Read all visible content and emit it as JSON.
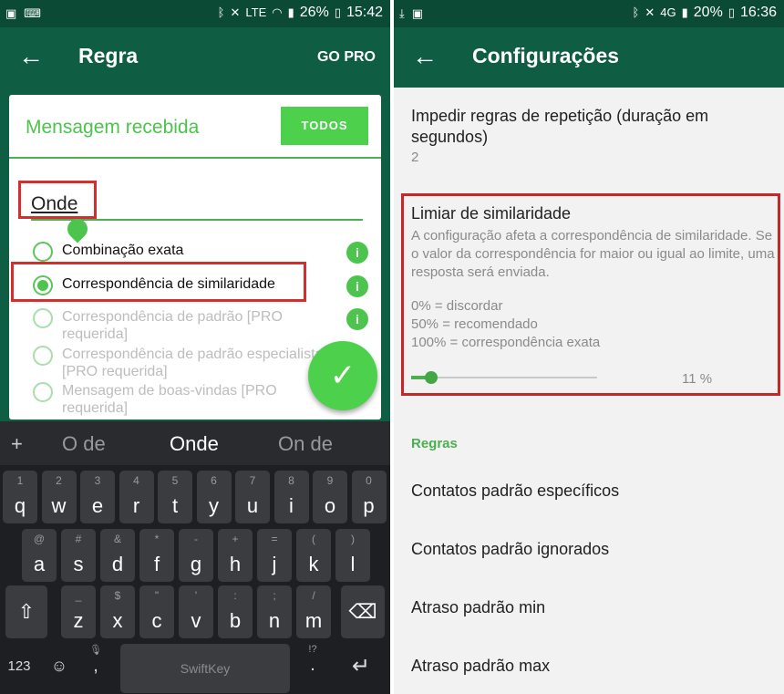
{
  "left": {
    "status": {
      "battery": "26%",
      "time": "15:42",
      "network": "LTE"
    },
    "appbar": {
      "back_icon": "arrow-left-icon",
      "title": "Regra",
      "action": "GO PRO"
    },
    "card": {
      "title": "Mensagem recebida",
      "todos_label": "TODOS",
      "input_value": "Onde",
      "options": [
        {
          "label": "Combinação exata",
          "checked": false,
          "disabled": false,
          "info": true
        },
        {
          "label": "Correspondência de similaridade",
          "checked": true,
          "disabled": false,
          "info": true
        },
        {
          "label": "Correspondência de padrão [PRO requerida]",
          "checked": false,
          "disabled": true,
          "info": true
        },
        {
          "label": "Correspondência de padrão especialista [PRO requerida]",
          "checked": false,
          "disabled": true,
          "info": false
        },
        {
          "label": "Mensagem de boas-vindas [PRO requerida]",
          "checked": false,
          "disabled": true,
          "info": false
        }
      ],
      "info_glyph": "i",
      "fab_icon": "check-icon"
    },
    "keyboard": {
      "plus": "+",
      "suggestions": [
        "O de",
        "Onde",
        "On de"
      ],
      "row1": [
        {
          "sub": "1",
          "main": "q"
        },
        {
          "sub": "2",
          "main": "w"
        },
        {
          "sub": "3",
          "main": "e"
        },
        {
          "sub": "4",
          "main": "r"
        },
        {
          "sub": "5",
          "main": "t"
        },
        {
          "sub": "6",
          "main": "y"
        },
        {
          "sub": "7",
          "main": "u"
        },
        {
          "sub": "8",
          "main": "i"
        },
        {
          "sub": "9",
          "main": "o"
        },
        {
          "sub": "0",
          "main": "p"
        }
      ],
      "row2": [
        {
          "sub": "@",
          "main": "a"
        },
        {
          "sub": "#",
          "main": "s"
        },
        {
          "sub": "&",
          "main": "d"
        },
        {
          "sub": "*",
          "main": "f"
        },
        {
          "sub": "-",
          "main": "g"
        },
        {
          "sub": "+",
          "main": "h"
        },
        {
          "sub": "=",
          "main": "j"
        },
        {
          "sub": "(",
          "main": "k"
        },
        {
          "sub": ")",
          "main": "l"
        }
      ],
      "row3": [
        {
          "sub": "_",
          "main": "z"
        },
        {
          "sub": "$",
          "main": "x"
        },
        {
          "sub": "\"",
          "main": "c"
        },
        {
          "sub": "'",
          "main": "v"
        },
        {
          "sub": ":",
          "main": "b"
        },
        {
          "sub": ";",
          "main": "n"
        },
        {
          "sub": "/",
          "main": "m"
        }
      ],
      "shift_icon": "shift-icon",
      "backspace_icon": "backspace-icon",
      "numbers_label": "123",
      "emoji_icon": "emoji-icon",
      "mic_icon": "mic-icon",
      "comma": ",",
      "period": ".",
      "period_sub": "!?",
      "space_label": "SwiftKey",
      "enter_icon": "enter-icon"
    }
  },
  "right": {
    "status": {
      "battery": "20%",
      "time": "16:36",
      "network": "4G"
    },
    "appbar": {
      "back_icon": "arrow-left-icon",
      "title": "Configurações"
    },
    "repeat": {
      "title": "Impedir regras de repetição (duração em segundos)",
      "value": "2"
    },
    "similarity": {
      "title": "Limiar de similaridade",
      "description": "A configuração afeta a correspondência de similaridade. Se o valor da correspondência for maior ou igual ao limite, uma resposta será enviada.",
      "scale": [
        "0% = discordar",
        "50% = recomendado",
        "100% = correspondência exata"
      ],
      "value_percent": 11,
      "value_label": "11 %"
    },
    "section": "Regras",
    "items": [
      "Contatos padrão específicos",
      "Contatos padrão ignorados",
      "Atraso padrão min",
      "Atraso padrão max"
    ]
  },
  "colors": {
    "primary_dark": "#0b4a35",
    "primary": "#0f5e44",
    "accent": "#4dd14d",
    "highlight": "#d32f2f"
  }
}
